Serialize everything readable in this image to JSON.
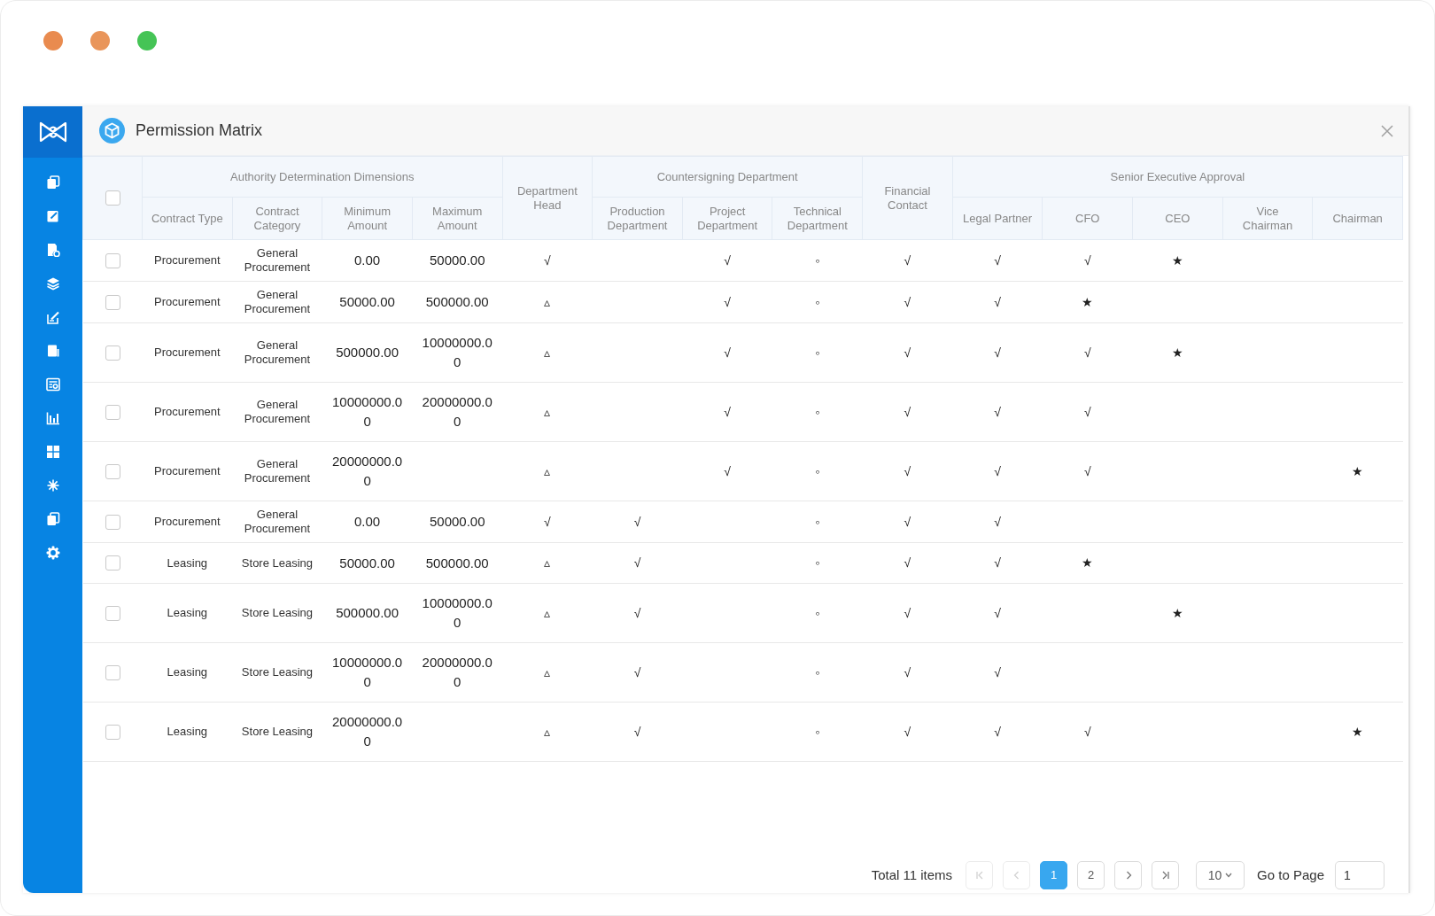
{
  "window_controls": [
    {
      "color": "#e98b4f"
    },
    {
      "color": "#e9955a"
    },
    {
      "color": "#45c456"
    }
  ],
  "dialog": {
    "title": "Permission Matrix"
  },
  "table": {
    "select_all": {
      "checked": false
    },
    "header_groups": [
      {
        "label": "Authority Determination Dimensions",
        "columns": [
          "Contract Type",
          "Contract Category",
          "Minimum Amount",
          "Maximum Amount"
        ]
      },
      {
        "label": "Department Head"
      },
      {
        "label": "Countersigning Department",
        "columns": [
          "Production Department",
          "Project Department",
          "Technical Department"
        ]
      },
      {
        "label": "Financial Contact"
      },
      {
        "label": "Senior Executive Approval",
        "columns": [
          "Legal Partner",
          "CFO",
          "CEO",
          "Vice Chairman",
          "Chairman"
        ]
      }
    ],
    "rows": [
      {
        "selected": false,
        "contract_type": "Procurement",
        "contract_category": "General Procurement",
        "minimum_amount": "0.00",
        "maximum_amount": "50000.00",
        "department_head": "√",
        "project_department": "√",
        "technical_department": "◦",
        "financial_contact": "√",
        "legal_partner": "√",
        "cfo": "√",
        "ceo": "★"
      },
      {
        "selected": false,
        "contract_type": "Procurement",
        "contract_category": "General Procurement",
        "minimum_amount": "50000.00",
        "maximum_amount": "500000.00",
        "department_head": "▵",
        "project_department": "√",
        "technical_department": "◦",
        "financial_contact": "√",
        "legal_partner": "√",
        "cfo": "★"
      },
      {
        "selected": false,
        "contract_type": "Procurement",
        "contract_category": "General Procurement",
        "minimum_amount": "500000.00",
        "maximum_amount": "10000000.00",
        "department_head": "▵",
        "project_department": "√",
        "technical_department": "◦",
        "financial_contact": "√",
        "legal_partner": "√",
        "cfo": "√",
        "ceo": "★"
      },
      {
        "selected": false,
        "contract_type": "Procurement",
        "contract_category": "General Procurement",
        "minimum_amount": "10000000.00",
        "maximum_amount": "20000000.00",
        "department_head": "▵",
        "project_department": "√",
        "technical_department": "◦",
        "financial_contact": "√",
        "legal_partner": "√",
        "cfo": "√"
      },
      {
        "selected": false,
        "contract_type": "Procurement",
        "contract_category": "General Procurement",
        "minimum_amount": "20000000.00",
        "department_head": "▵",
        "project_department": "√",
        "technical_department": "◦",
        "financial_contact": "√",
        "legal_partner": "√",
        "cfo": "√",
        "chairman": "★"
      },
      {
        "selected": false,
        "contract_type": "Procurement",
        "contract_category": "General Procurement",
        "minimum_amount": "0.00",
        "maximum_amount": "50000.00",
        "department_head": "√",
        "production_department": "√",
        "technical_department": "◦",
        "financial_contact": "√",
        "legal_partner": "√"
      },
      {
        "selected": false,
        "contract_type": "Leasing",
        "contract_category": "Store Leasing",
        "minimum_amount": "50000.00",
        "maximum_amount": "500000.00",
        "department_head": "▵",
        "production_department": "√",
        "technical_department": "◦",
        "financial_contact": "√",
        "legal_partner": "√",
        "cfo": "★"
      },
      {
        "selected": false,
        "contract_type": "Leasing",
        "contract_category": "Store Leasing",
        "minimum_amount": "500000.00",
        "maximum_amount": "10000000.00",
        "department_head": "▵",
        "production_department": "√",
        "technical_department": "◦",
        "financial_contact": "√",
        "legal_partner": "√",
        "ceo": "★"
      },
      {
        "selected": false,
        "contract_type": "Leasing",
        "contract_category": "Store Leasing",
        "minimum_amount": "10000000.00",
        "maximum_amount": "20000000.00",
        "department_head": "▵",
        "production_department": "√",
        "technical_department": "◦",
        "financial_contact": "√",
        "legal_partner": "√"
      },
      {
        "selected": false,
        "contract_type": "Leasing",
        "contract_category": "Store Leasing",
        "minimum_amount": "20000000.00",
        "department_head": "▵",
        "production_department": "√",
        "technical_department": "◦",
        "financial_contact": "√",
        "legal_partner": "√",
        "cfo": "√",
        "chairman": "★"
      }
    ]
  },
  "pagination": {
    "total": "Total 11 items",
    "first": {
      "disabled": true
    },
    "previous": {
      "disabled": true
    },
    "pages": [
      {
        "label": "1",
        "selected": true
      },
      {
        "label": "2",
        "selected": false
      }
    ],
    "next": {
      "disabled": false
    },
    "last": {
      "disabled": false
    },
    "page_size": "10",
    "go_to_label": "Go to Page",
    "go_to_value": "1"
  }
}
